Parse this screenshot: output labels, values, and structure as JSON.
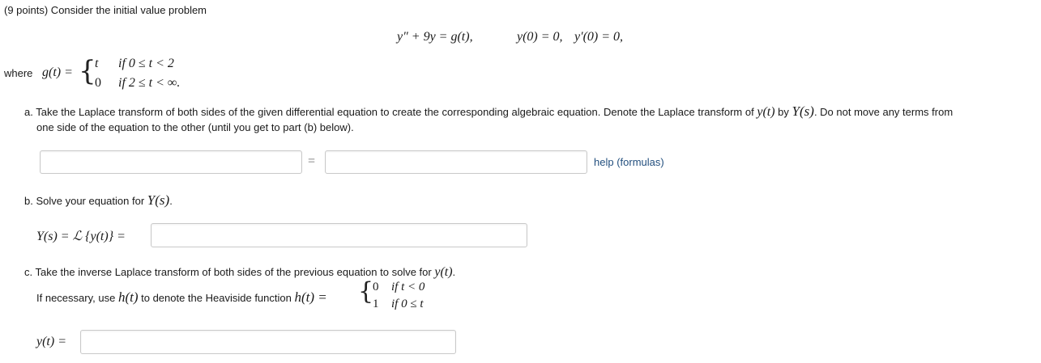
{
  "problem": {
    "header": "(9 points) Consider the initial value problem",
    "equation": "y″ + 9y = g(t),",
    "ic1": "y(0) = 0,",
    "ic2": "y′(0) = 0,",
    "where_label": "where",
    "g_lhs": "g(t) =",
    "case1_value": "t",
    "case1_cond": "if 0 ≤ t < 2",
    "case2_value": "0",
    "case2_cond": "if 2 ≤ t < ∞."
  },
  "part_a": {
    "text_line1": "a. Take the Laplace transform of both sides of the given differential equation to create the corresponding algebraic equation. Denote the Laplace transform of",
    "y_t": "y(t)",
    "by": "by",
    "Y_s": "Y(s)",
    "text_line1_end": ". Do not move any terms from",
    "text_line2": "one side of the equation to the other (until you get to part (b) below).",
    "lhs_value": "",
    "equals": "=",
    "rhs_value": "",
    "help_link": "help (formulas)"
  },
  "part_b": {
    "text": "b. Solve your equation for",
    "Y_s": "Y(s)",
    "period": ".",
    "lhs": "Y(s) = ℒ {y(t)} =",
    "answer_value": ""
  },
  "part_c": {
    "text": "c. Take the inverse Laplace transform of both sides of the previous equation to solve for",
    "y_t": "y(t)",
    "period": ".",
    "heaviside_text": "If necessary, use",
    "h_t": "h(t)",
    "heaviside_text2": "to denote the Heaviside function",
    "h_lhs": "h(t) =",
    "h_case1_value": "0",
    "h_case1_cond": "if t < 0",
    "h_case2_value": "1",
    "h_case2_cond": "if 0 ≤ t",
    "lhs": "y(t) =",
    "answer_value": ""
  }
}
